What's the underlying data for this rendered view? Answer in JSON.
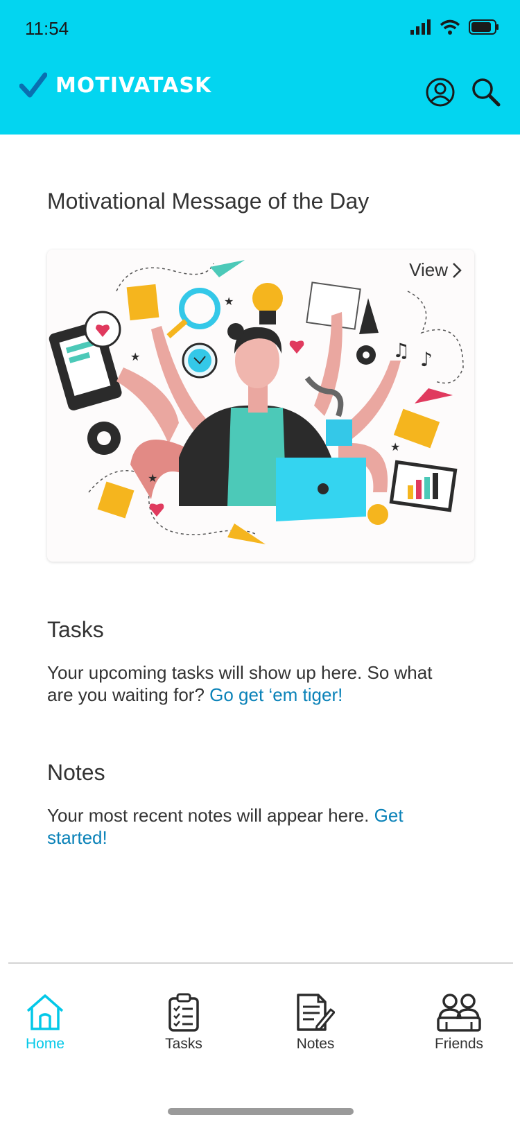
{
  "status_bar": {
    "time": "11:54"
  },
  "header": {
    "app_name": "MOTIVATASK",
    "bg_color": "#03d5f0"
  },
  "motivation": {
    "title": "Motivational Message of the Day",
    "view_label": "View"
  },
  "tasks": {
    "title": "Tasks",
    "text": "Your upcoming tasks will show up here. So what are you waiting for? ",
    "link": "Go get ‘em tiger!"
  },
  "notes": {
    "title": "Notes",
    "text": "Your most recent notes will appear here. ",
    "link": "Get started!"
  },
  "tabbar": {
    "items": [
      {
        "label": "Home",
        "icon": "home-icon",
        "active": true
      },
      {
        "label": "Tasks",
        "icon": "clipboard-icon",
        "active": false
      },
      {
        "label": "Notes",
        "icon": "notes-icon",
        "active": false
      },
      {
        "label": "Friends",
        "icon": "friends-icon",
        "active": false
      }
    ],
    "active_color": "#03c8e8"
  },
  "colors": {
    "accent": "#03d5f0",
    "link": "#0a82b8"
  }
}
